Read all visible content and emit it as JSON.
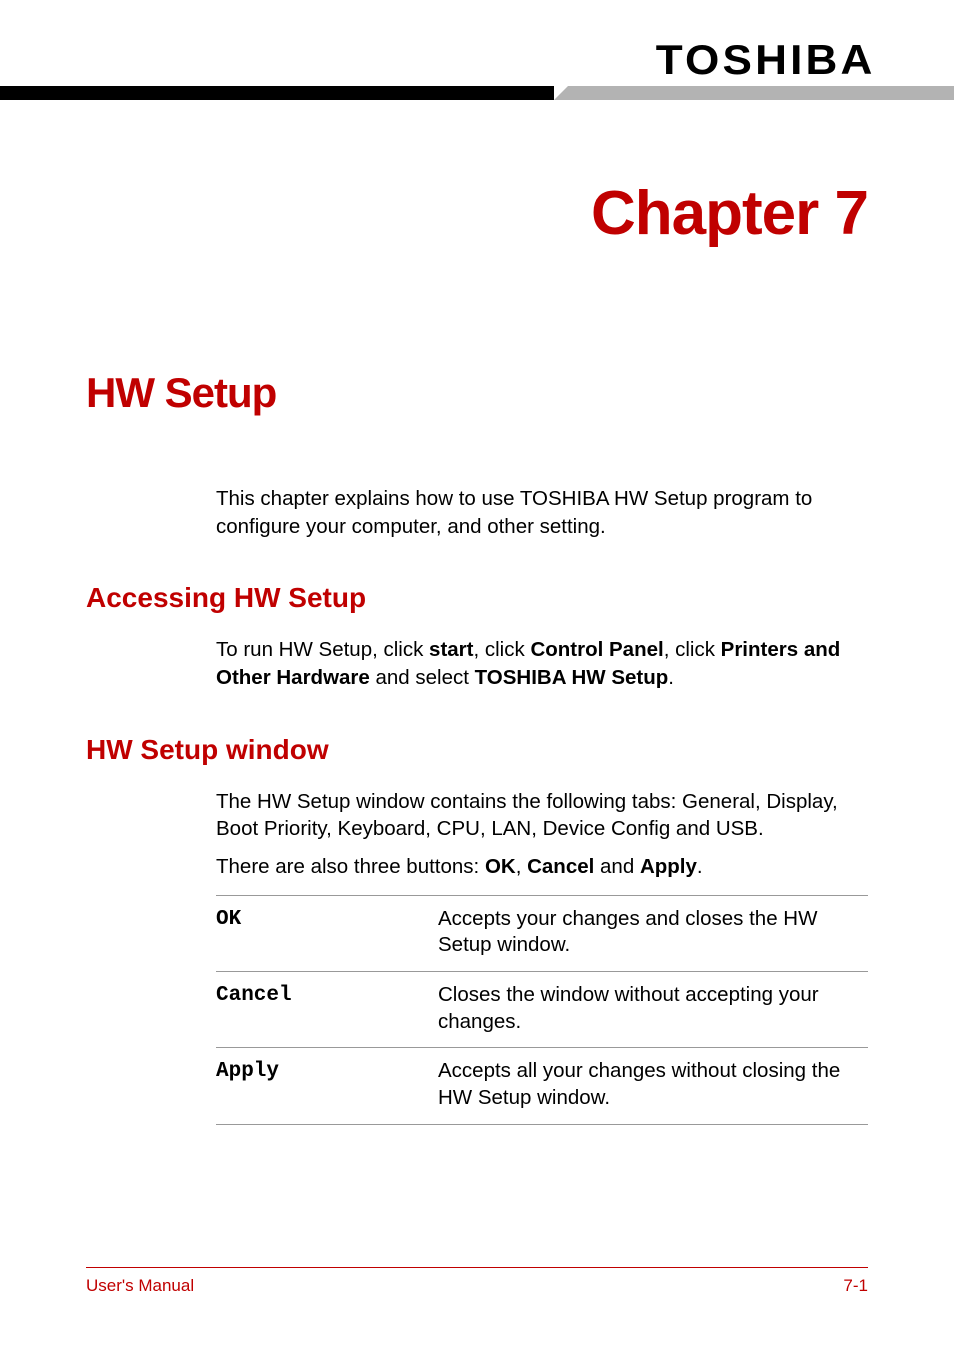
{
  "brand": "TOSHIBA",
  "chapter_title": "Chapter 7",
  "section_title": "HW Setup",
  "intro_text": "This chapter explains how to use TOSHIBA HW Setup program to configure your computer, and other setting.",
  "subsections": [
    {
      "heading": "Accessing HW Setup",
      "run_text": {
        "t1": "To run HW Setup, click ",
        "b1": "start",
        "t2": ", click ",
        "b2": "Control Panel",
        "t3": ", click ",
        "b3": "Printers and Other Hardware",
        "t4": " and select ",
        "b4": "TOSHIBA HW Setup",
        "t5": "."
      }
    },
    {
      "heading": "HW Setup window",
      "para1": "The HW Setup window contains the following tabs: General, Display, Boot Priority, Keyboard, CPU, LAN, Device Config and USB.",
      "para2": {
        "t1": "There are also three buttons: ",
        "b1": "OK",
        "t2": ", ",
        "b2": "Cancel",
        "t3": " and ",
        "b3": "Apply",
        "t4": "."
      },
      "rows": [
        {
          "label": "OK",
          "desc": "Accepts your changes and closes the HW Setup window."
        },
        {
          "label": "Cancel",
          "desc": "Closes the window without accepting your changes."
        },
        {
          "label": "Apply",
          "desc": "Accepts all your changes without closing the HW Setup window."
        }
      ]
    }
  ],
  "footer": {
    "left": "User's Manual",
    "right": "7-1"
  }
}
